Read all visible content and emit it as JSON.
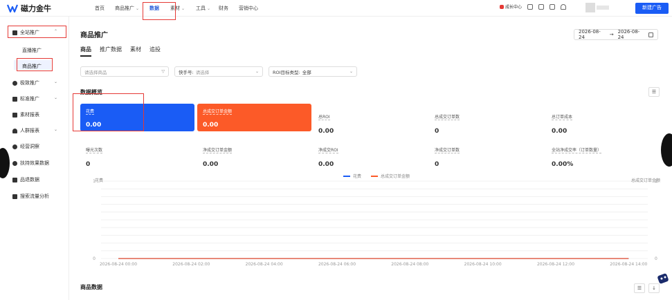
{
  "app": {
    "name": "磁力金牛"
  },
  "topnav": {
    "items": [
      {
        "label": "首页",
        "has_caret": false
      },
      {
        "label": "商品推广",
        "has_caret": true
      },
      {
        "label": "数据",
        "has_caret": false
      },
      {
        "label": "素材",
        "has_caret": true
      },
      {
        "label": "工具",
        "has_caret": true
      },
      {
        "label": "财务",
        "has_caret": false
      },
      {
        "label": "营销中心",
        "has_caret": false
      }
    ],
    "active": "数据",
    "vip_label": "成长中心",
    "new_ad_label": "新建广告"
  },
  "sidebar": {
    "items": [
      {
        "label": "全站推广",
        "expanded": true
      },
      {
        "label": "直播推广"
      },
      {
        "label": "商品推广"
      },
      {
        "label": "极致推广"
      },
      {
        "label": "标准推广"
      },
      {
        "label": "素材报表"
      },
      {
        "label": "人群报表"
      },
      {
        "label": "经营洞察"
      },
      {
        "label": "扶持效果数据"
      },
      {
        "label": "品退数据"
      },
      {
        "label": "搜索流量分析"
      }
    ]
  },
  "main": {
    "title": "商品推广",
    "date_start": "2026-08-24",
    "date_sep": "→",
    "date_end": "2026-08-24",
    "tabs": [
      "商品",
      "推广数据",
      "素材",
      "追投"
    ],
    "filters": {
      "product_placeholder": "请选择商品",
      "kuaishou_label": "快手号:",
      "kuaishou_placeholder": "请选择",
      "roi_label": "ROI目标类型:",
      "roi_value": "全部"
    },
    "section_title": "数据概览",
    "cards": [
      {
        "label": "花费",
        "value": "0.00"
      },
      {
        "label": "总成交订单金额",
        "value": "0.00"
      },
      {
        "label": "总ROI",
        "value": "0.00"
      },
      {
        "label": "总成交订单数",
        "value": "0"
      },
      {
        "label": "总订单成本",
        "value": "0.00"
      },
      {
        "label": "曝光次数",
        "value": "0"
      },
      {
        "label": "净成交订单金额",
        "value": "0.00"
      },
      {
        "label": "净成交ROI",
        "value": "0.00"
      },
      {
        "label": "净成交订单数",
        "value": "0"
      },
      {
        "label": "全站净成交率（订单数量）",
        "value": "0.00%"
      }
    ],
    "bottom_title": "商品数据"
  },
  "chart_data": {
    "type": "line",
    "x": [
      "2026-08-24 00:00",
      "2026-08-24 02:00",
      "2026-08-24 04:00",
      "2026-08-24 06:00",
      "2026-08-24 08:00",
      "2026-08-24 10:00",
      "2026-08-24 12:00",
      "2026-08-24 14:00"
    ],
    "series": [
      {
        "name": "花费",
        "values": [
          0,
          0,
          0,
          0,
          0,
          0,
          0,
          0
        ],
        "color": "#1a5cf5"
      },
      {
        "name": "总成交订单金额",
        "values": [
          0,
          0,
          0,
          0,
          0,
          0,
          0,
          0
        ],
        "color": "#fc5a28"
      }
    ],
    "ylabel_left": "花费",
    "ylabel_right": "总成交订单金额",
    "y_ticks": [
      "1",
      "0"
    ],
    "ylim": [
      0,
      1
    ],
    "grid": true,
    "legend": "top-center"
  },
  "colors": {
    "accent": "#1a5cf5",
    "orange": "#fc5a28",
    "highlight": "#e53935"
  }
}
